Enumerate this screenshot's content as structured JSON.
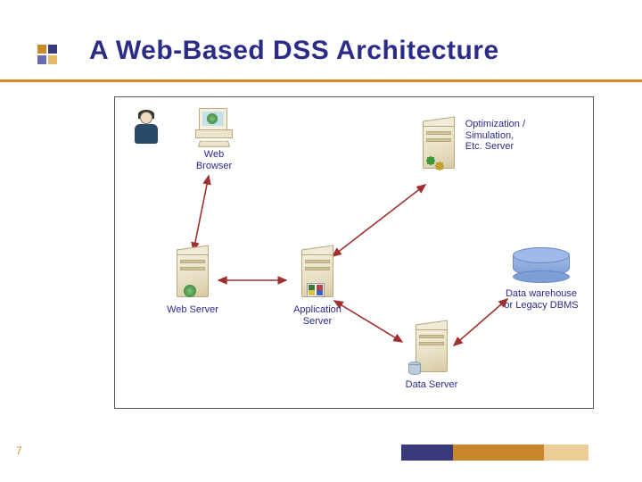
{
  "slide": {
    "title": "A Web-Based DSS Architecture",
    "page_number": "7"
  },
  "diagram": {
    "nodes": {
      "user": {
        "label": ""
      },
      "browser": {
        "label": "Web\nBrowser"
      },
      "web_server": {
        "label": "Web Server"
      },
      "app_server": {
        "label": "Application\nServer"
      },
      "opt_server": {
        "label": "Optimization /\nSimulation,\nEtc. Server"
      },
      "data_server": {
        "label": "Data Server"
      },
      "warehouse": {
        "label": "Data warehouse\nor Legacy DBMS"
      }
    },
    "edges": [
      {
        "from": "browser",
        "to": "web_server",
        "bidir": true
      },
      {
        "from": "web_server",
        "to": "app_server",
        "bidir": true
      },
      {
        "from": "app_server",
        "to": "opt_server",
        "bidir": true
      },
      {
        "from": "app_server",
        "to": "data_server",
        "bidir": true
      },
      {
        "from": "data_server",
        "to": "warehouse",
        "bidir": true
      }
    ]
  }
}
